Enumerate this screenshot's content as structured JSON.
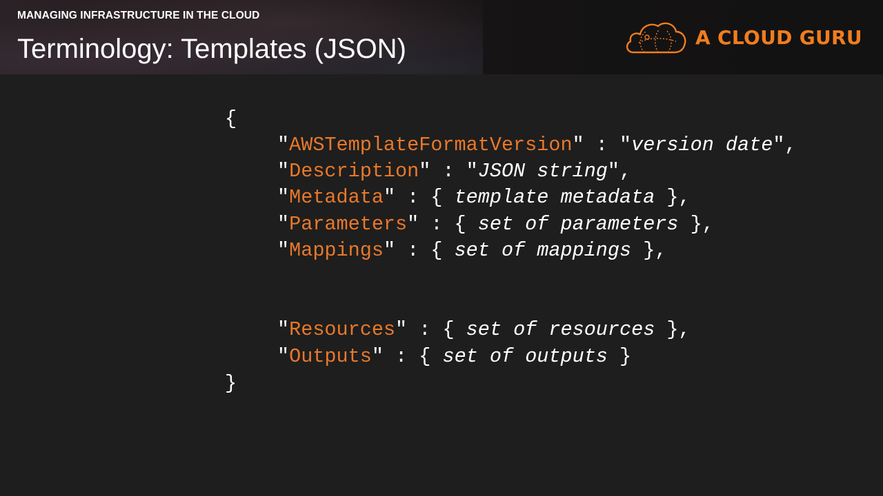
{
  "header": {
    "course_title": "MANAGING INFRASTRUCTURE IN THE CLOUD",
    "slide_title": "Terminology: Templates (JSON)",
    "logo_text": "A CLOUD GURU",
    "logo_icon": "cloud-logo-icon"
  },
  "colors": {
    "accent": "#f07d1e",
    "key_text": "#e8782a",
    "background": "#1e1e1e"
  },
  "code": {
    "open_brace": "{",
    "close_brace": "}",
    "lines": [
      {
        "q1": "\"",
        "key": "AWSTemplateFormatVersion",
        "sep": "\" : \"",
        "value": "version date",
        "end": "\","
      },
      {
        "q1": "\"",
        "key": "Description",
        "sep": "\" : \"",
        "value": "JSON string",
        "end": "\","
      },
      {
        "q1": "\"",
        "key": "Metadata",
        "sep": "\" : { ",
        "value": "template metadata",
        "end": " },"
      },
      {
        "q1": "\"",
        "key": "Parameters",
        "sep": "\" : { ",
        "value": "set of parameters",
        "end": " },"
      },
      {
        "q1": "\"",
        "key": "Mappings",
        "sep": "\" : { ",
        "value": "set of mappings",
        "end": " },"
      },
      {
        "q1": "\"",
        "key": "Resources",
        "sep": "\" : { ",
        "value": "set of resources",
        "end": " },"
      },
      {
        "q1": "\"",
        "key": "Outputs",
        "sep": "\" : { ",
        "value": "set of outputs",
        "end": " }"
      }
    ]
  }
}
